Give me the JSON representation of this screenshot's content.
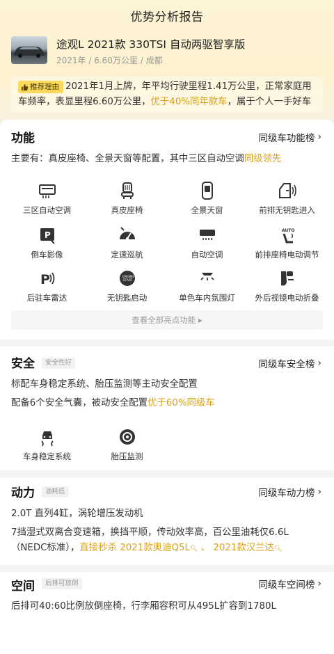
{
  "header": {
    "title": "优势分析报告"
  },
  "car": {
    "name": "途观L 2021款 330TSI 自动两驱智享版",
    "meta": "2021年 / 6.60万公里 / 成都"
  },
  "reason": {
    "tag": "推荐理由",
    "text_a": "2021年1月上牌，年平均行驶里程1.41万公里，正常家庭用车频率，表显里程6.60万公里，",
    "text_hl": "优于40%同年款车",
    "text_b": "，属于个人一手好车"
  },
  "features": {
    "title": "功能",
    "link": "同级车功能榜",
    "summary_a": "主要有：真皮座椅、全景天窗等配置，其中三区自动空调",
    "summary_hl": "同级领先",
    "items": [
      {
        "label": "三区自动空调",
        "icon": "ac-panel-icon"
      },
      {
        "label": "真皮座椅",
        "icon": "seat-icon"
      },
      {
        "label": "全景天窗",
        "icon": "sunroof-icon"
      },
      {
        "label": "前排无钥匙进入",
        "icon": "keyless-door-icon"
      },
      {
        "label": "倒车影像",
        "icon": "reverse-camera-icon"
      },
      {
        "label": "定速巡航",
        "icon": "cruise-gauge-icon"
      },
      {
        "label": "自动空调",
        "icon": "auto-ac-icon"
      },
      {
        "label": "前排座椅电动调节",
        "icon": "power-seat-icon"
      },
      {
        "label": "后驻车雷达",
        "icon": "parking-radar-icon"
      },
      {
        "label": "无钥匙启动",
        "icon": "start-stop-icon"
      },
      {
        "label": "单色车内氛围灯",
        "icon": "ambient-light-icon"
      },
      {
        "label": "外后视镜电动折叠",
        "icon": "mirror-fold-icon"
      }
    ],
    "more": "查看全部亮点功能"
  },
  "safety": {
    "title": "安全",
    "badge": "安全性好",
    "link": "同级车安全榜",
    "line1": "标配车身稳定系统、胎压监测等主动安全配置",
    "line2_a": "配备6个安全气囊，被动安全配置",
    "line2_hl": "优于60%同级车",
    "items": [
      {
        "label": "车身稳定系统",
        "icon": "stability-control-icon"
      },
      {
        "label": "胎压监测",
        "icon": "tire-pressure-icon"
      }
    ]
  },
  "power": {
    "title": "动力",
    "badge": "油耗低",
    "link": "同级车动力榜",
    "line1": "2.0T 直列4缸，涡轮增压发动机",
    "line2": "7挡湿式双离合变速箱，换挡平顺，传动效率高，百公里油耗仅6.6L（NEDC标准），",
    "line2_hl": "直接秒杀",
    "compare1": "2021款奥迪Q5L",
    "compare_sep": "、",
    "compare2": "2021款汉兰达"
  },
  "space": {
    "title": "空间",
    "badge": "后排可放倒",
    "link": "同级车空间榜",
    "line1": "后排可40:60比例放倒座椅，行李厢容积可从495L扩容到1780L"
  },
  "colors": {
    "accent": "#d9a21a",
    "tag_bg": "#fbd95c",
    "hero_bg": "#fdf3d6"
  }
}
